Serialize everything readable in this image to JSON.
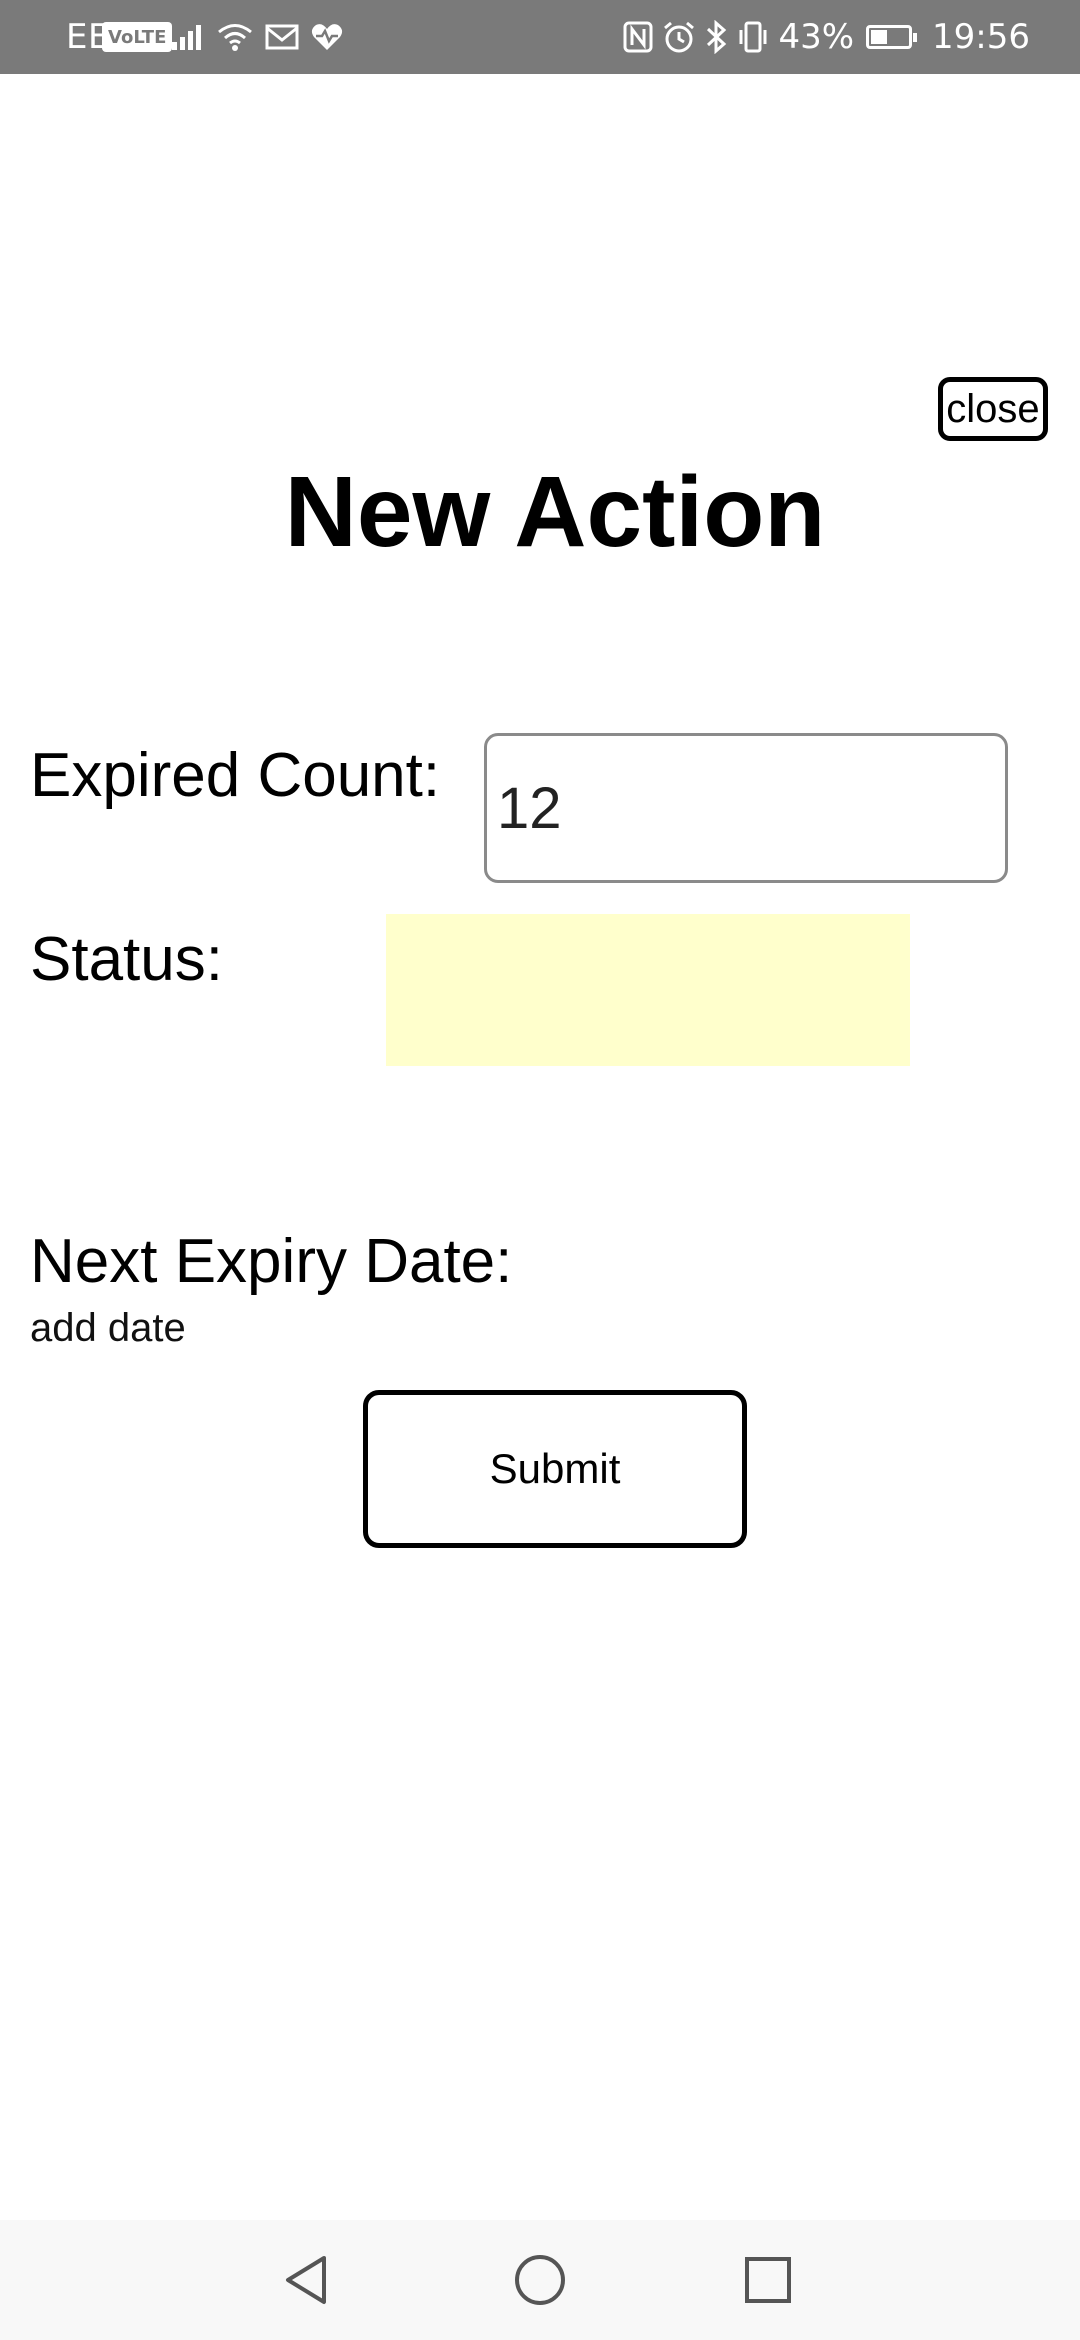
{
  "status_bar": {
    "carrier": "EE",
    "volte": "VoLTE",
    "battery_percent": "43%",
    "time": "19:56",
    "icons_left": [
      "signal-icon",
      "wifi-icon",
      "mail-icon",
      "health-icon"
    ],
    "icons_right": [
      "nfc-icon",
      "alarm-icon",
      "bluetooth-icon",
      "vibrate-icon",
      "battery-icon"
    ]
  },
  "dialog": {
    "close_label": "close",
    "title": "New Action",
    "expired_count_label": "Expired Count:",
    "expired_count_value": "12",
    "status_label": "Status:",
    "status_color": "#ffffcc",
    "next_expiry_label": "Next Expiry Date:",
    "add_date_link": "add date",
    "submit_label": "Submit"
  },
  "nav_bar": {
    "buttons": [
      "back-icon",
      "home-icon",
      "recents-icon"
    ]
  }
}
